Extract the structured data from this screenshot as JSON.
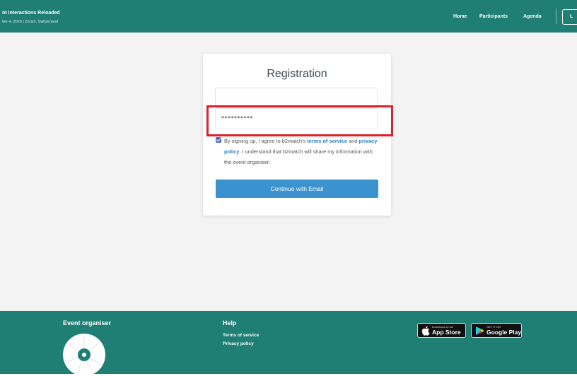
{
  "header": {
    "event_name": "nt Interactions Reloaded",
    "event_date": "ber 4, 2020 | Zürich, Switzerland",
    "nav": {
      "home": "Home",
      "participants": "Participants",
      "agenda": "Agenda"
    },
    "login_label": "L"
  },
  "registration": {
    "title": "Registration",
    "email": {
      "value": ""
    },
    "password": {
      "value": "**********"
    },
    "terms_checked": true,
    "terms": {
      "prefix": "By signing up, I agree to b2match's ",
      "terms_link": "terms of service",
      "and": " and ",
      "privacy_link": "privacy policy",
      "suffix": ". I understand that b2match will share my information with the event organiser."
    },
    "continue_label": "Continue with Email"
  },
  "footer": {
    "organiser_title": "Event organiser",
    "help_title": "Help",
    "help_links": {
      "terms": "Terms of service",
      "privacy": "Privacy policy"
    },
    "app_store": {
      "small": "Download on the",
      "big": "App Store",
      "icon": "apple-icon"
    },
    "google_play": {
      "small": "GET IT ON",
      "big": "Google Play",
      "icon": "play-icon"
    }
  },
  "colors": {
    "brand_teal": "#1f7f75",
    "button_blue": "#3a92cf",
    "link_blue": "#2f7fc1",
    "highlight_red": "#e21f26"
  }
}
